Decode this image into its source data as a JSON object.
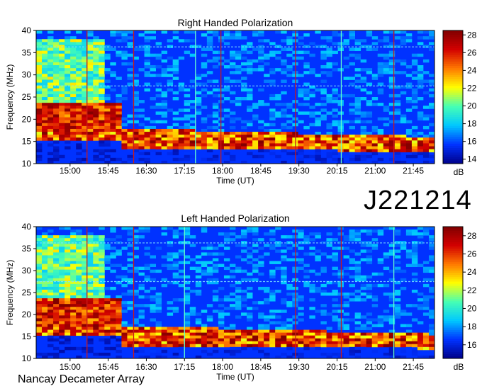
{
  "header": {
    "id_label": "J221214"
  },
  "footer": {
    "observatory": "Nancay Decameter Array"
  },
  "chart_data": [
    {
      "type": "heatmap",
      "title": "Right Handed Polarization",
      "xlabel": "Time (UT)",
      "ylabel": "Frequency (MHz)",
      "x_ticks": [
        "15:00",
        "15:45",
        "16:30",
        "17:15",
        "18:00",
        "18:45",
        "19:30",
        "20:15",
        "21:00",
        "21:45"
      ],
      "y_ticks": [
        10,
        15,
        20,
        25,
        30,
        35,
        40
      ],
      "ylim": [
        10,
        40
      ],
      "xlim": [
        "14:20",
        "22:10"
      ],
      "colorbar": {
        "label": "dB",
        "ticks": [
          14,
          16,
          18,
          20,
          22,
          24,
          26,
          28
        ],
        "range": [
          13.5,
          28.5
        ]
      },
      "features": {
        "intense_band_mhz": [
          13.5,
          18.5
        ],
        "early_burst_mhz": [
          17,
          24
        ],
        "early_burst_end": "15:58",
        "interference_lines_mhz": [
          36.3,
          27.5
        ],
        "vertical_lines_time": [
          "15:20",
          "16:15",
          "17:28",
          "17:58",
          "19:26",
          "20:20",
          "21:22"
        ]
      },
      "colors": [
        "#00008a",
        "#0032ff",
        "#00c8ff",
        "#46ffb4",
        "#ffff00",
        "#ff7800",
        "#d20000",
        "#800000"
      ]
    },
    {
      "type": "heatmap",
      "title": "Left Handed Polarization",
      "xlabel": "Time (UT)",
      "ylabel": "Frequency (MHz)",
      "x_ticks": [
        "15:00",
        "15:45",
        "16:30",
        "17:15",
        "18:00",
        "18:45",
        "19:30",
        "20:15",
        "21:00",
        "21:45"
      ],
      "y_ticks": [
        10,
        15,
        20,
        25,
        30,
        35,
        40
      ],
      "ylim": [
        10,
        40
      ],
      "xlim": [
        "14:20",
        "22:10"
      ],
      "colorbar": {
        "label": "dB",
        "ticks": [
          16,
          18,
          20,
          22,
          24,
          26,
          28
        ],
        "range": [
          14.5,
          29.0
        ]
      },
      "features": {
        "intense_band_mhz": [
          13,
          18
        ],
        "early_burst_mhz": [
          17,
          24
        ],
        "early_burst_end": "15:58",
        "interference_lines_mhz": [
          36.3,
          27.5
        ],
        "vertical_lines_time": [
          "15:20",
          "16:15",
          "17:15",
          "19:26",
          "20:20",
          "21:22"
        ]
      },
      "colors": [
        "#00008a",
        "#0032ff",
        "#00c8ff",
        "#46ffb4",
        "#ffff00",
        "#ff7800",
        "#d20000",
        "#800000"
      ]
    }
  ]
}
